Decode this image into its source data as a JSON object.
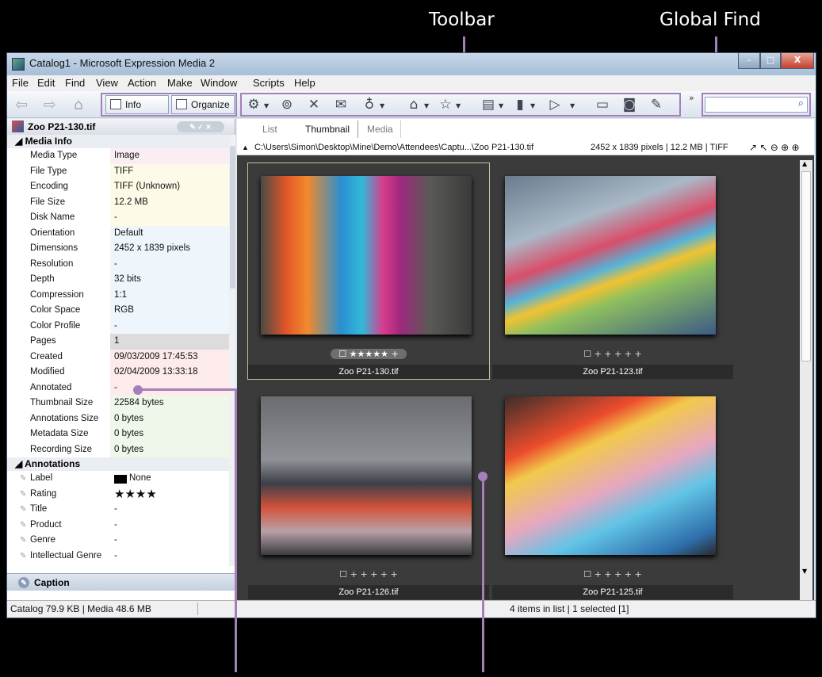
{
  "callouts": {
    "toolbar": "Toolbar",
    "global_find": "Global Find"
  },
  "window": {
    "title": "Catalog1 - Microsoft Expression Media 2",
    "minimize": "–",
    "maximize": "□",
    "close": "X"
  },
  "menu": [
    "File",
    "Edit",
    "Find",
    "View",
    "Action",
    "Make",
    "Window",
    "Scripts",
    "Help"
  ],
  "toolbar": {
    "info_label": "Info",
    "organize_label": "Organize",
    "more": "»"
  },
  "left_panel": {
    "header": "Zoo P21-130.tif",
    "media_info_title": "Media Info",
    "media_info": [
      {
        "key": "Media Type",
        "value": "Image",
        "color": "#fbeef2"
      },
      {
        "key": "File Type",
        "value": "TIFF",
        "color": "#fdfbe8"
      },
      {
        "key": "Encoding",
        "value": "TIFF (Unknown)",
        "color": "#fdfbe8"
      },
      {
        "key": "File Size",
        "value": "12.2 MB",
        "color": "#fdfbe8"
      },
      {
        "key": "Disk Name",
        "value": "-",
        "color": "#fdfbe8"
      },
      {
        "key": "Orientation",
        "value": "Default",
        "color": "#eef5fb"
      },
      {
        "key": "Dimensions",
        "value": "2452 x 1839 pixels",
        "color": "#eef5fb"
      },
      {
        "key": "Resolution",
        "value": "-",
        "color": "#eef5fb"
      },
      {
        "key": "Depth",
        "value": "32 bits",
        "color": "#eef5fb"
      },
      {
        "key": "Compression",
        "value": "1:1",
        "color": "#eef5fb"
      },
      {
        "key": "Color Space",
        "value": "RGB",
        "color": "#eef5fb"
      },
      {
        "key": "Color Profile",
        "value": "-",
        "color": "#eef5fb"
      },
      {
        "key": "Pages",
        "value": "1",
        "color": "#dcdcdc"
      },
      {
        "key": "Created",
        "value": "09/03/2009 17:45:53",
        "color": "#fcebea"
      },
      {
        "key": "Modified",
        "value": "02/04/2009 13:33:18",
        "color": "#fcebea"
      },
      {
        "key": "Annotated",
        "value": "-",
        "color": "#fcebea"
      },
      {
        "key": "Thumbnail Size",
        "value": "22584 bytes",
        "color": "#eef7ea"
      },
      {
        "key": "Annotations Size",
        "value": "0 bytes",
        "color": "#eef7ea"
      },
      {
        "key": "Metadata Size",
        "value": "0 bytes",
        "color": "#eef7ea"
      },
      {
        "key": "Recording Size",
        "value": "0 bytes",
        "color": "#eef7ea"
      }
    ],
    "annotations_title": "Annotations",
    "annotations": [
      {
        "key": "Label",
        "value": "None"
      },
      {
        "key": "Rating",
        "value": "★★★★"
      },
      {
        "key": "Title",
        "value": "-"
      },
      {
        "key": "Product",
        "value": "-"
      },
      {
        "key": "Genre",
        "value": "-"
      },
      {
        "key": "Intellectual Genre",
        "value": "-"
      }
    ],
    "caption": "Caption"
  },
  "view_tabs": [
    "List",
    "Thumbnail",
    "Media"
  ],
  "path": {
    "text": "C:\\Users\\Simon\\Desktop\\Mine\\Demo\\Attendees\\Captu...\\Zoo P21-130.tif",
    "info": "2452 x 1839 pixels  |  12.2 MB  |  TIFF"
  },
  "thumbnails": [
    {
      "name": "Zoo P21-130.tif",
      "rating": "★★★★★",
      "selected": true
    },
    {
      "name": "Zoo P21-123.tif",
      "rating": "",
      "selected": false
    },
    {
      "name": "Zoo P21-126.tif",
      "rating": "",
      "selected": false
    },
    {
      "name": "Zoo P21-125.tif",
      "rating": "",
      "selected": false
    }
  ],
  "status": {
    "left": "Catalog  79.9 KB  |  Media 48.6 MB",
    "right": "4 items in list  |  1 selected [1]"
  }
}
